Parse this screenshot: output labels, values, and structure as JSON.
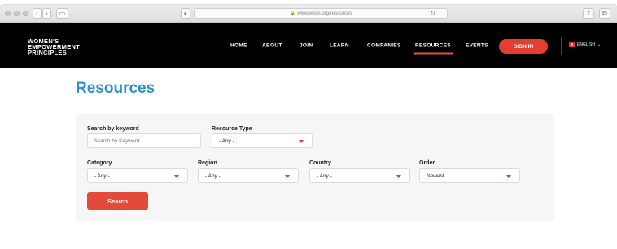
{
  "browser": {
    "url": "www.weps.org/resources",
    "lock_icon": "lock-icon",
    "refresh_icon": "refresh-icon"
  },
  "site": {
    "logo": [
      "WOMEN'S",
      "EMPOWERMENT",
      "PRINCIPLES"
    ],
    "nav": [
      {
        "label": "HOME",
        "active": false
      },
      {
        "label": "ABOUT",
        "active": false
      },
      {
        "label": "JOIN",
        "active": false
      },
      {
        "label": "LEARN",
        "active": false
      },
      {
        "label": "COMPANIES",
        "active": false
      },
      {
        "label": "RESOURCES",
        "active": true
      },
      {
        "label": "EVENTS",
        "active": false
      }
    ],
    "signin_label": "SIGN IN",
    "language": "ENGLISH",
    "accent_color": "#e33f30",
    "title_color": "#2f91d0"
  },
  "page": {
    "title": "Resources"
  },
  "filters": {
    "keyword": {
      "label": "Search by keyword",
      "placeholder": "Search by Keyword",
      "value": ""
    },
    "resource_type": {
      "label": "Resource Type",
      "value": "- Any -"
    },
    "category": {
      "label": "Category",
      "value": "- Any -"
    },
    "region": {
      "label": "Region",
      "value": "- Any -"
    },
    "country": {
      "label": "Country",
      "value": "- Any -"
    },
    "order": {
      "label": "Order",
      "value": "Newest"
    },
    "search_label": "Search"
  }
}
